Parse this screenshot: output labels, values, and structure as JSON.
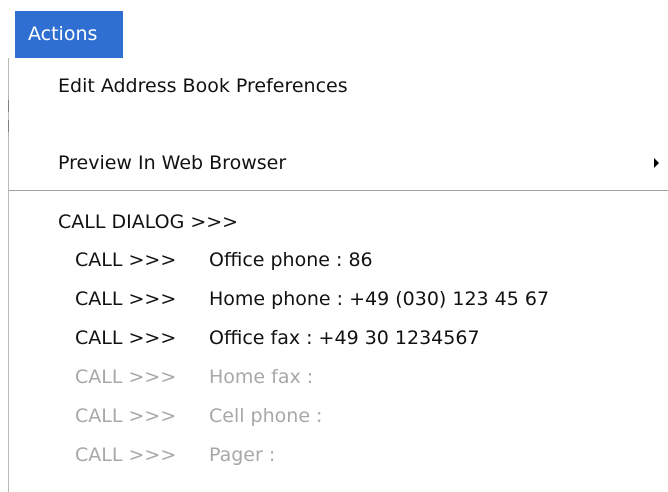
{
  "menu": {
    "title": "Actions"
  },
  "items": {
    "edit_prefs": "Edit Address Book Preferences",
    "preview": "Preview In Web Browser"
  },
  "call_dialog": {
    "header": "CALL DIALOG  >>>",
    "prefix": "CALL >>>",
    "entries": [
      {
        "label": "Office phone : 86",
        "enabled": true
      },
      {
        "label": "Home phone : +49 (030) 123 45 67",
        "enabled": true
      },
      {
        "label": "Office fax : +49 30 1234567",
        "enabled": true
      },
      {
        "label": "Home fax :",
        "enabled": false
      },
      {
        "label": "Cell phone :",
        "enabled": false
      },
      {
        "label": "Pager :",
        "enabled": false
      }
    ]
  },
  "colors": {
    "menu_highlight": "#2f6fd1",
    "disabled_text": "#a8a8a8"
  }
}
